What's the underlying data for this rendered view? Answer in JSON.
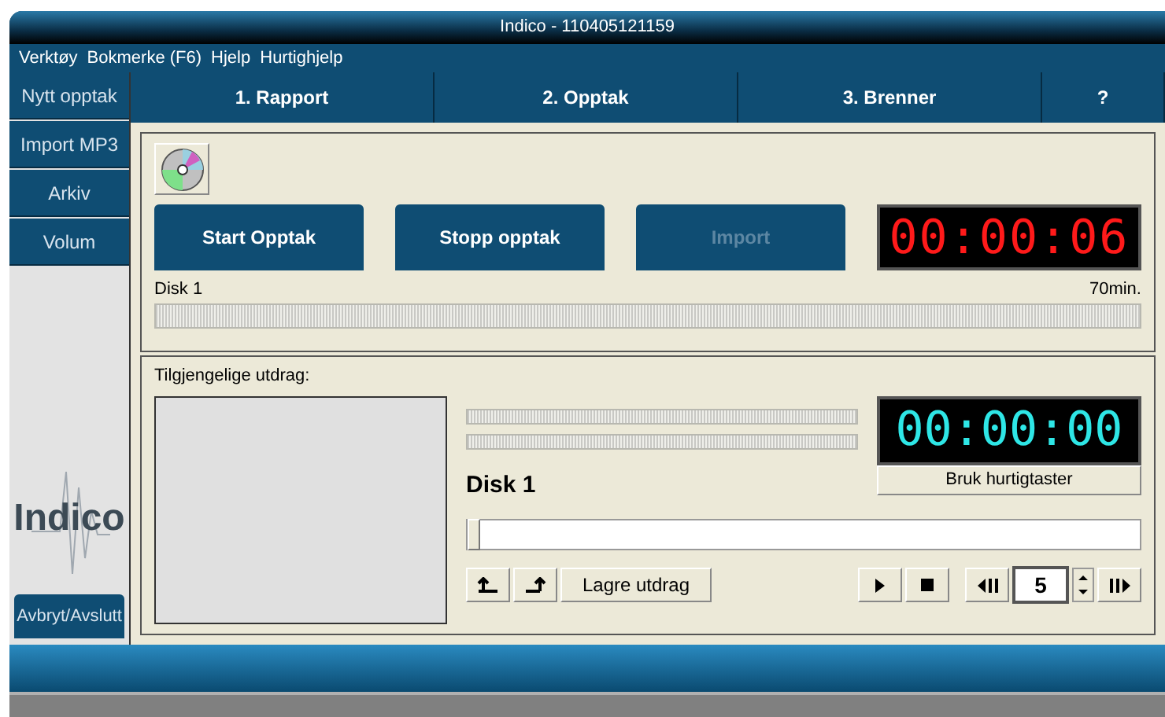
{
  "window": {
    "title": "Indico - 110405121159"
  },
  "menu": [
    "Verktøy",
    "Bokmerke (F6)",
    "Hjelp",
    "Hurtighjelp"
  ],
  "sidebar": {
    "items": [
      "Nytt opptak",
      "Import MP3",
      "Arkiv",
      "Volum"
    ],
    "logo": "Indico",
    "exit_button": "Avbryt/Avslutt"
  },
  "tabs": [
    "1. Rapport",
    "2. Opptak",
    "3. Brenner",
    "?"
  ],
  "recording": {
    "buttons": [
      {
        "label": "Start Opptak",
        "disabled": false
      },
      {
        "label": "Stopp opptak",
        "disabled": false
      },
      {
        "label": "Import",
        "disabled": true
      }
    ],
    "timer": "00:00:06",
    "disk_label": "Disk 1",
    "capacity": "70min."
  },
  "excerpts": {
    "title": "Tilgjengelige utdrag:",
    "disk_label": "Disk 1",
    "timer": "00:00:00",
    "shortcut_button": "Bruk hurtigtaster",
    "position": {
      "level": 0
    },
    "save_button": "Lagre utdrag",
    "step_value": "5"
  }
}
